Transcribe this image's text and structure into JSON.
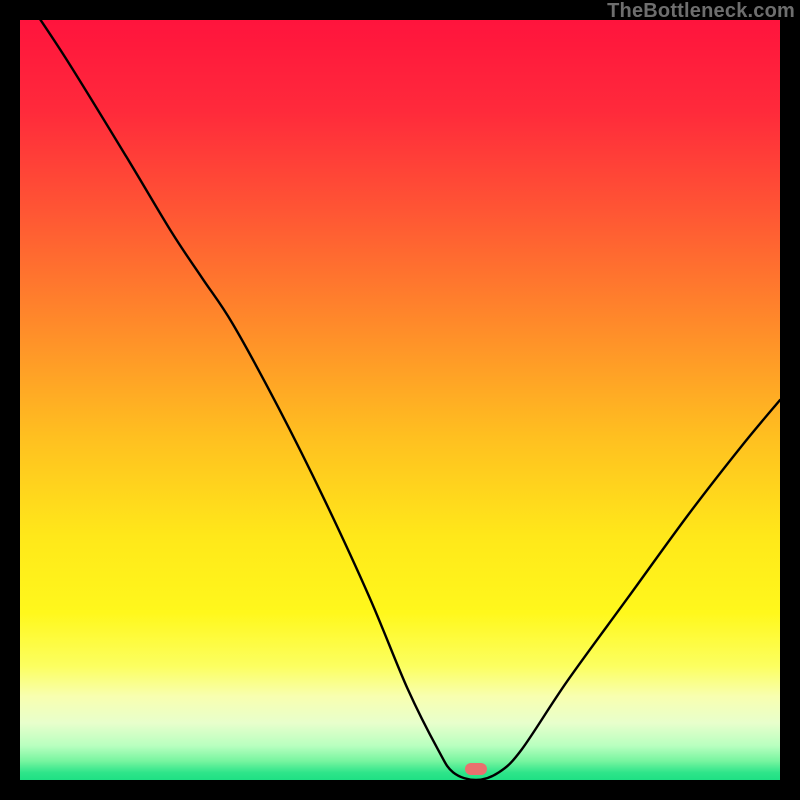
{
  "attribution": "TheBottleneck.com",
  "gradient_stops": [
    {
      "offset": 0.0,
      "color": "#ff143d"
    },
    {
      "offset": 0.12,
      "color": "#ff2a3b"
    },
    {
      "offset": 0.25,
      "color": "#ff5534"
    },
    {
      "offset": 0.4,
      "color": "#ff8a2a"
    },
    {
      "offset": 0.55,
      "color": "#ffc020"
    },
    {
      "offset": 0.68,
      "color": "#ffe81a"
    },
    {
      "offset": 0.78,
      "color": "#fff81c"
    },
    {
      "offset": 0.85,
      "color": "#fcff60"
    },
    {
      "offset": 0.89,
      "color": "#f8ffb0"
    },
    {
      "offset": 0.925,
      "color": "#e8ffcc"
    },
    {
      "offset": 0.955,
      "color": "#b8ffbf"
    },
    {
      "offset": 0.975,
      "color": "#78f5a0"
    },
    {
      "offset": 0.99,
      "color": "#2fe58a"
    },
    {
      "offset": 1.0,
      "color": "#1ee084"
    }
  ],
  "marker": {
    "x_pct": 60,
    "y_pct": 98.5,
    "w": 22,
    "h": 12,
    "color": "#e9706e"
  },
  "chart_data": {
    "type": "line",
    "title": "",
    "xlabel": "",
    "ylabel": "",
    "xlim": [
      0,
      100
    ],
    "ylim": [
      0,
      100
    ],
    "series": [
      {
        "name": "bottleneck-curve",
        "points": [
          {
            "x": 0,
            "y": 104
          },
          {
            "x": 6,
            "y": 95
          },
          {
            "x": 14,
            "y": 82
          },
          {
            "x": 20,
            "y": 72
          },
          {
            "x": 24,
            "y": 66
          },
          {
            "x": 28,
            "y": 60
          },
          {
            "x": 34,
            "y": 49
          },
          {
            "x": 40,
            "y": 37
          },
          {
            "x": 46,
            "y": 24
          },
          {
            "x": 51,
            "y": 12
          },
          {
            "x": 55,
            "y": 4
          },
          {
            "x": 57,
            "y": 1
          },
          {
            "x": 60,
            "y": 0
          },
          {
            "x": 63,
            "y": 1
          },
          {
            "x": 66,
            "y": 4
          },
          {
            "x": 72,
            "y": 13
          },
          {
            "x": 80,
            "y": 24
          },
          {
            "x": 88,
            "y": 35
          },
          {
            "x": 95,
            "y": 44
          },
          {
            "x": 100,
            "y": 50
          }
        ]
      }
    ],
    "background": "vertical heat gradient (red→green)",
    "marker": {
      "x": 60,
      "y": 0,
      "shape": "pill",
      "color": "#e9706e"
    }
  }
}
